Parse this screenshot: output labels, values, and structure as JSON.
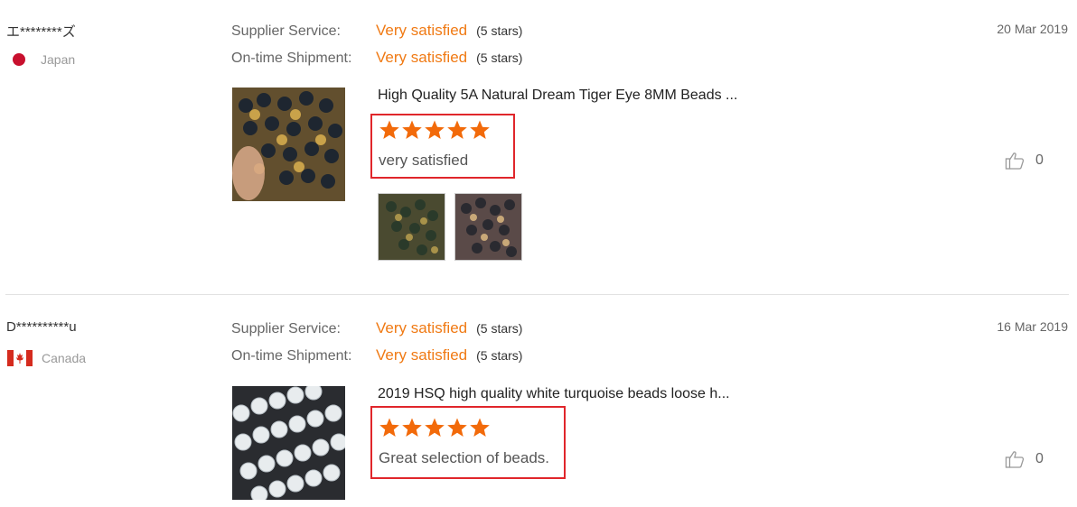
{
  "reviews": [
    {
      "buyer": "エ********ズ",
      "country": "Japan",
      "supplier_service_label": "Supplier Service:",
      "supplier_service_value": "Very satisfied",
      "supplier_service_stars": "(5 stars)",
      "shipment_label": "On-time Shipment:",
      "shipment_value": "Very satisfied",
      "shipment_stars": "(5 stars)",
      "date": "20 Mar 2019",
      "product_title": "High Quality 5A Natural Dream Tiger Eye 8MM Beads ...",
      "rating": 5,
      "feedback": "very satisfied",
      "likes": "0"
    },
    {
      "buyer": "D**********u",
      "country": "Canada",
      "supplier_service_label": "Supplier Service:",
      "supplier_service_value": "Very satisfied",
      "supplier_service_stars": "(5 stars)",
      "shipment_label": "On-time Shipment:",
      "shipment_value": "Very satisfied",
      "shipment_stars": "(5 stars)",
      "date": "16 Mar 2019",
      "product_title": "2019 HSQ high quality white turquoise beads loose h...",
      "rating": 5,
      "feedback": "Great selection of beads.",
      "likes": "0"
    }
  ],
  "colors": {
    "accent": "#f07a14",
    "highlight_box": "#e0262b",
    "star": "#f26a0a"
  },
  "icons": {
    "like": "thumbs-up-icon",
    "star": "star-icon"
  }
}
